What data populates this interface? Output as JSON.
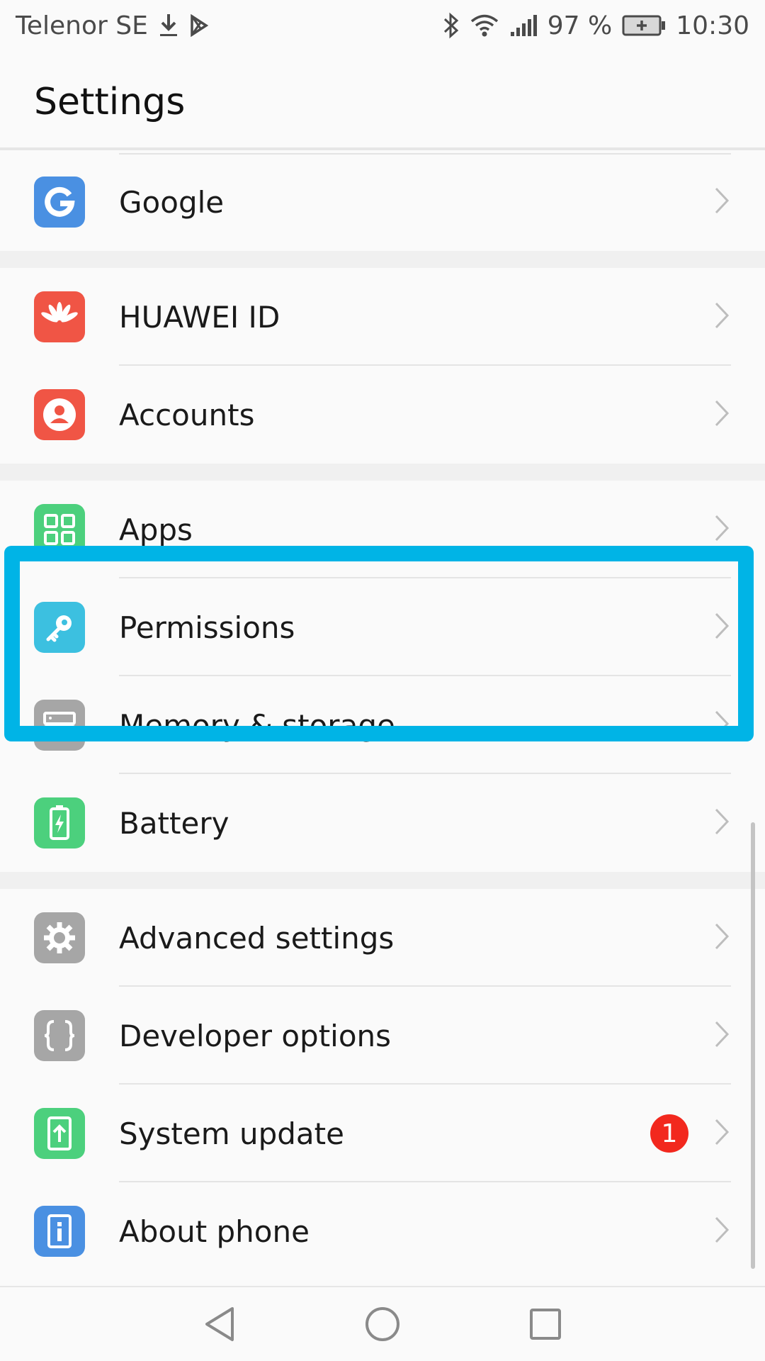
{
  "status_bar": {
    "carrier": "Telenor SE",
    "battery_percent": "97 %",
    "time": "10:30"
  },
  "header": {
    "title": "Settings"
  },
  "settings": {
    "google": "Google",
    "huawei_id": "HUAWEI ID",
    "accounts": "Accounts",
    "apps": "Apps",
    "permissions": "Permissions",
    "memory_storage": "Memory & storage",
    "battery": "Battery",
    "advanced_settings": "Advanced settings",
    "developer_options": "Developer options",
    "system_update": "System update",
    "system_update_badge": "1",
    "about_phone": "About phone"
  },
  "colors": {
    "highlight": "#00b4e6",
    "google_icon": "#4a90e2",
    "huawei_icon": "#f05545",
    "accounts_icon": "#f05545",
    "apps_icon": "#4cd07d",
    "permissions_icon": "#3cc0e0",
    "memory_icon": "#a6a6a6",
    "battery_icon": "#4cd07d",
    "advanced_icon": "#a6a6a6",
    "developer_icon": "#a6a6a6",
    "update_icon": "#4cd07d",
    "about_icon": "#4a90e2",
    "badge": "#f2281e"
  },
  "icons": [
    "download-icon",
    "play-store-icon",
    "bluetooth-icon",
    "wifi-icon",
    "signal-icon",
    "battery-charging-icon",
    "google-icon",
    "huawei-logo-icon",
    "person-icon",
    "apps-grid-icon",
    "key-icon",
    "storage-icon",
    "battery-icon",
    "gear-icon",
    "braces-icon",
    "update-arrow-icon",
    "info-icon",
    "chevron-right-icon",
    "back-icon",
    "home-icon",
    "recents-icon"
  ]
}
